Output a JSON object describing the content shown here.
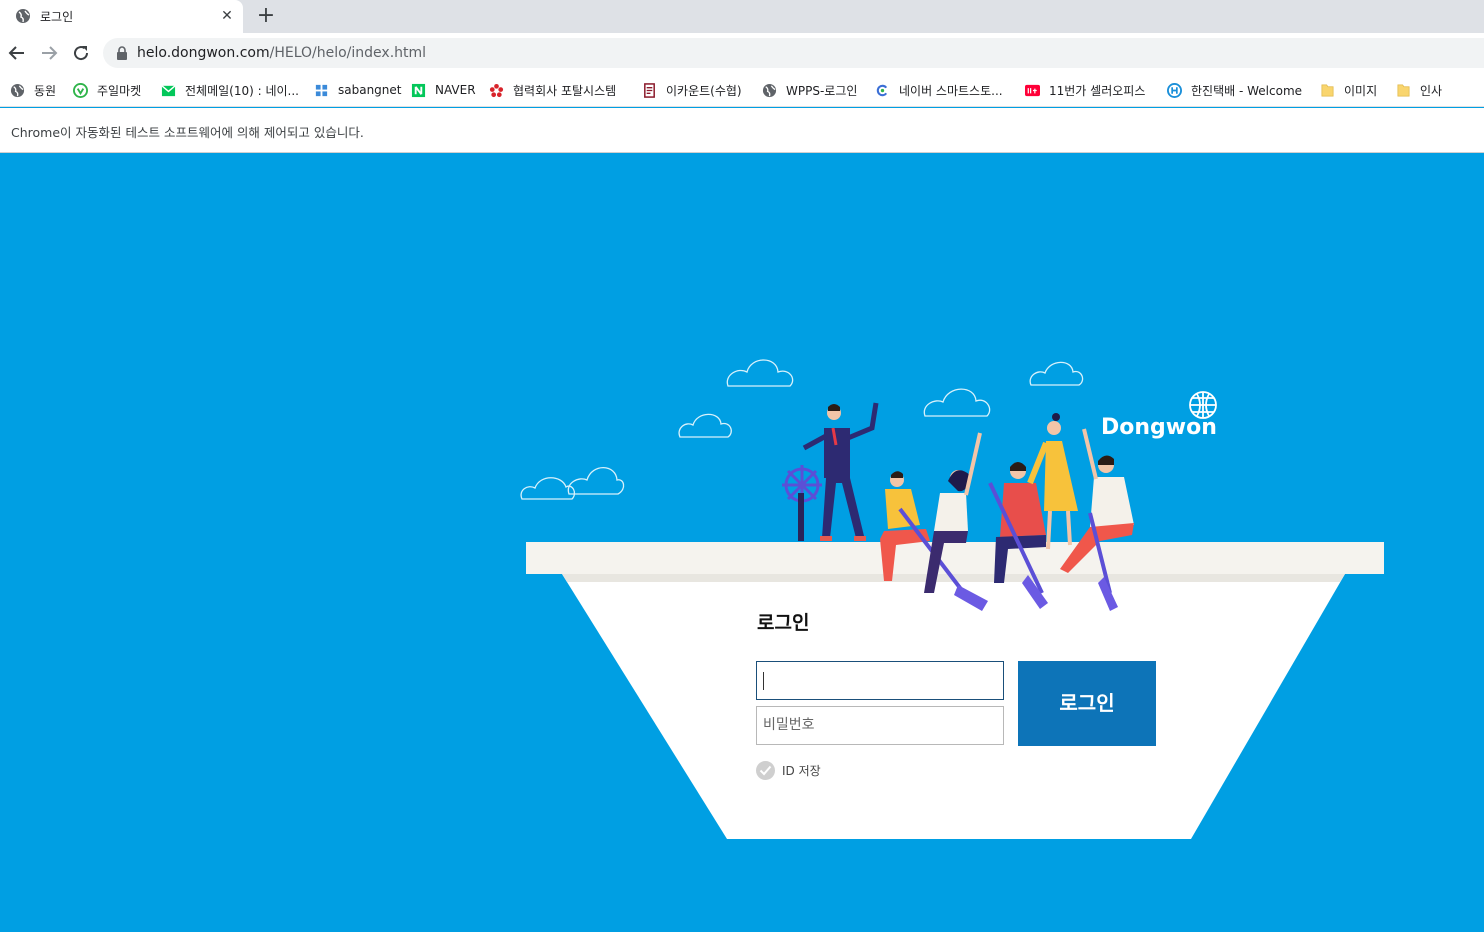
{
  "browser": {
    "tab": {
      "title": "로그인",
      "close": "✕",
      "new_tab": "+"
    },
    "url": {
      "host": "helo.dongwon.com",
      "path": "/HELO/helo/index.html"
    },
    "bookmarks": [
      {
        "label": "동원",
        "icon": "globe-icon"
      },
      {
        "label": "주일마켓",
        "icon": "shield-green-icon"
      },
      {
        "label": "전체메일(10) : 네이...",
        "icon": "mail-icon"
      },
      {
        "label": "sabangnet",
        "icon": "windows-icon"
      },
      {
        "label": "NAVER",
        "icon": "naver-icon"
      },
      {
        "label": "협력회사 포탈시스템",
        "icon": "flower-icon"
      },
      {
        "label": "이카운트(수협)",
        "icon": "ecount-icon"
      },
      {
        "label": "WPPS-로그인",
        "icon": "globe-icon"
      },
      {
        "label": "네이버 스마트스토...",
        "icon": "smartstore-icon"
      },
      {
        "label": "11번가 셀러오피스",
        "icon": "11st-icon"
      },
      {
        "label": "한진택배 - Welcome",
        "icon": "hanjin-icon"
      },
      {
        "label": "이미지",
        "icon": "folder-icon"
      },
      {
        "label": "인사",
        "icon": "folder-icon"
      }
    ],
    "infobar": "Chrome이 자동화된 테스트 소프트웨어에 의해 제어되고 있습니다."
  },
  "page": {
    "brand": "Dongwon",
    "login_title": "로그인",
    "id_value": "",
    "password_placeholder": "비밀번호",
    "login_button": "로그인",
    "save_id_label": "ID 저장",
    "colors": {
      "background": "#009fe3",
      "button": "#0d74b8",
      "deck": "#f5f3ee"
    }
  }
}
